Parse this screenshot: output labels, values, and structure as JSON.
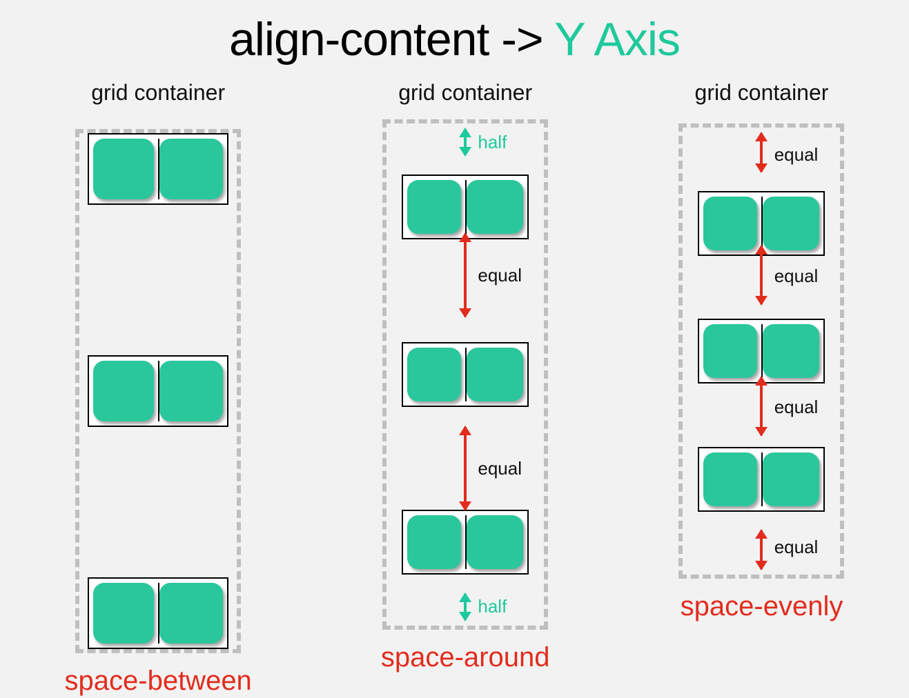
{
  "title": {
    "prefix": "align-content -> ",
    "accent": "Y Axis"
  },
  "containerLabel": "grid container",
  "columns": {
    "between": {
      "caption": "space-between"
    },
    "around": {
      "caption": "space-around",
      "halfLabel": "half",
      "equalLabel": "equal"
    },
    "evenly": {
      "caption": "space-evenly",
      "equalLabel": "equal"
    }
  }
}
